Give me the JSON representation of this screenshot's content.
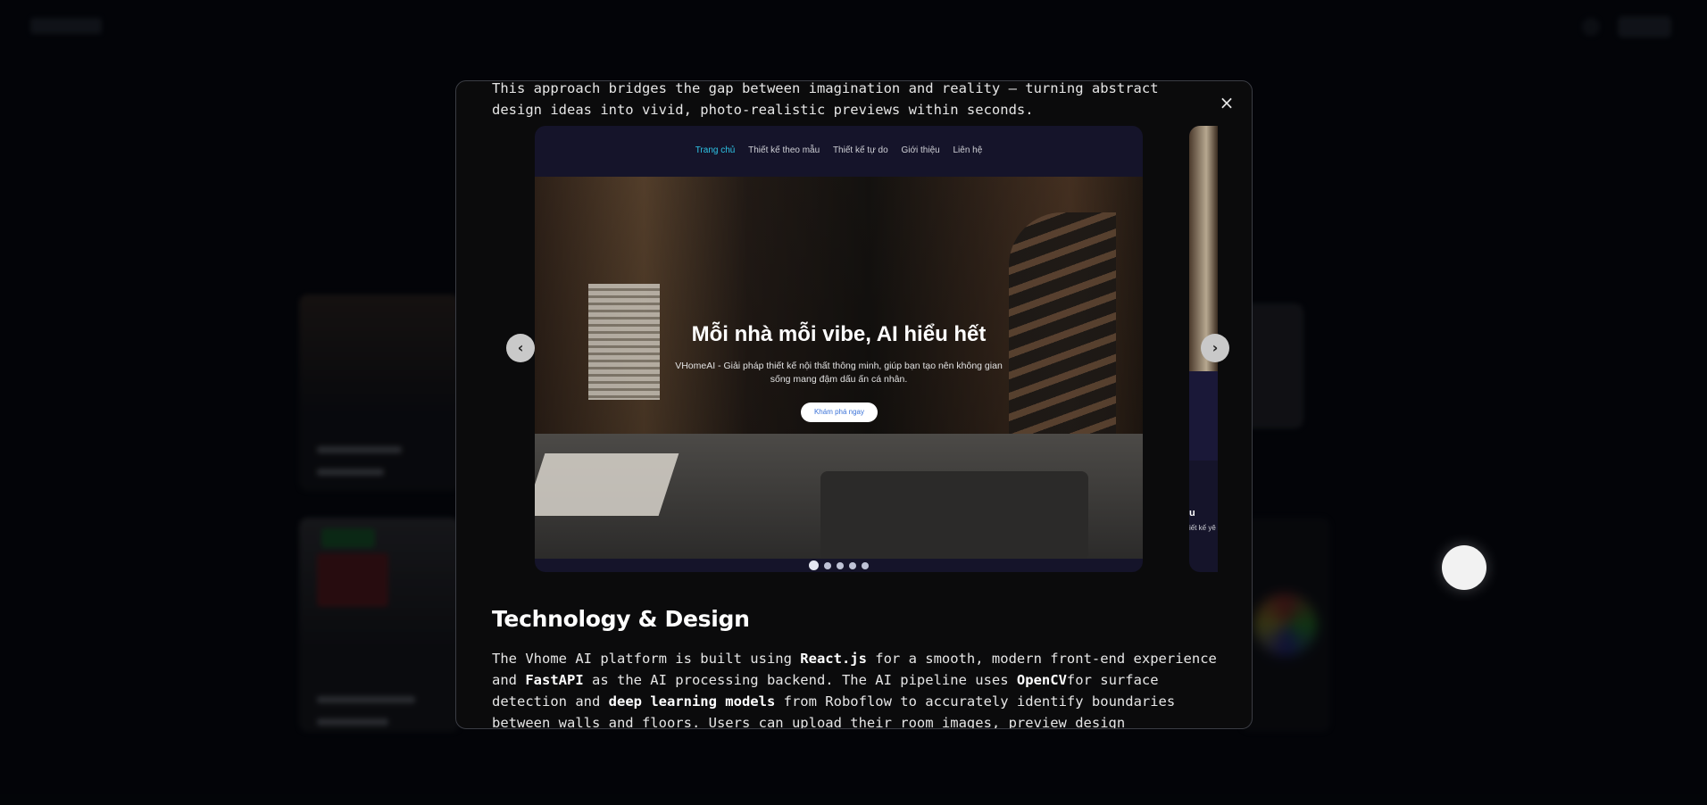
{
  "modal": {
    "close_icon": "×",
    "intro_text": "This approach bridges the gap between imagination and reality — turning abstract design ideas into vivid, photo-realistic previews within seconds.",
    "carousel": {
      "nav_items": [
        "Trang chủ",
        "Thiết kế theo mẫu",
        "Thiết kế tự do",
        "Giới thiệu",
        "Liên hệ"
      ],
      "active_nav": "Trang chủ",
      "hero_title": "Mỗi nhà mỗi vibe, AI hiểu hết",
      "hero_subtitle": "VHomeAI - Giải pháp thiết kế nội thất thông minh, giúp bạn tạo nên không gian sống mang đậm dấu ấn cá nhân.",
      "hero_button": "Khám phá ngay",
      "prev_icon": "‹",
      "next_icon": "›",
      "dot_count": 5,
      "active_dot": 0,
      "peek_heading": "u",
      "peek_text": "iết kế yê"
    },
    "section_title": "Technology & Design",
    "paragraph": {
      "p1": "The Vhome AI platform is built using ",
      "react": "React.js",
      "p2": " for a smooth, modern front-end experience and ",
      "fastapi": "FastAPI",
      "p3": " as the AI processing backend. The AI pipeline uses ",
      "opencv": "OpenCV",
      "p4": "for surface detection and ",
      "dl": "deep learning models",
      "p5": " from Roboflow to accurately identify boundaries between walls and floors. Users can upload their room images, preview design transformations instantly, and"
    }
  },
  "colors": {
    "accent_nav": "#2ec4e6",
    "modal_bg": "#0b0b0c",
    "hero_button_text": "#3a72d8"
  }
}
